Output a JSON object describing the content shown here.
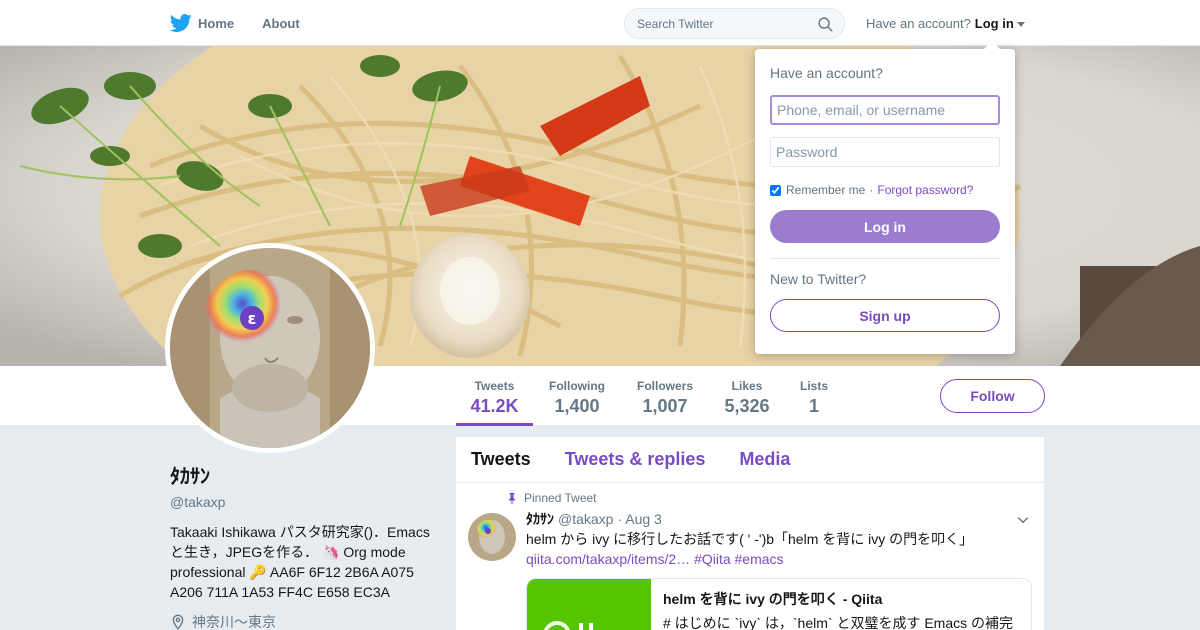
{
  "nav": {
    "home_label": "Home",
    "about_label": "About",
    "search_placeholder": "Search Twitter",
    "have_account": "Have an account?",
    "login_label": "Log in"
  },
  "profile": {
    "name": "ﾀｶｻﾝ",
    "handle": "@takaxp",
    "bio": "Takaaki Ishikawa パスタ研究家()．Emacs と生き，JPEGを作る． 🦄 Org mode professional 🔑 AA6F 6F12 2B6A A075 A206 711A 1A53 FF4C E658 EC3A",
    "location": "神奈川〜東京"
  },
  "stats": [
    {
      "label": "Tweets",
      "value": "41.2K",
      "active": true
    },
    {
      "label": "Following",
      "value": "1,400"
    },
    {
      "label": "Followers",
      "value": "1,007"
    },
    {
      "label": "Likes",
      "value": "5,326"
    },
    {
      "label": "Lists",
      "value": "1"
    }
  ],
  "follow_label": "Follow",
  "timeline": {
    "tabs": [
      "Tweets",
      "Tweets & replies",
      "Media"
    ],
    "pinned_label": "Pinned Tweet",
    "tweet": {
      "name": "ﾀｶｻﾝ",
      "handle": "@takaxp",
      "date": "· Aug 3",
      "text": "helm から ivy に移行したお話です( ' -')b「helm を背に ivy の門を叩く」",
      "link": "qiita.com/takaxp/items/2…",
      "hashtags": "#Qiita #emacs",
      "card_title": "helm を背に ivy の門を叩く - Qiita",
      "card_desc": "# はじめに `ivy` は，`helm` と双璧を成す Emacs の補完"
    }
  },
  "login_dropdown": {
    "title": "Have an account?",
    "username_placeholder": "Phone, email, or username",
    "password_placeholder": "Password",
    "remember_label": "Remember me",
    "forgot_label": "Forgot password?",
    "login_button": "Log in",
    "new_label": "New to Twitter?",
    "signup_button": "Sign up"
  },
  "colors": {
    "accent": "#794bc4",
    "login_button": "#9b7cd0",
    "qiita_green": "#55c500"
  },
  "icons": [
    "twitter-bird-icon",
    "search-icon",
    "caret-down-icon",
    "pin-icon",
    "location-icon",
    "chevron-down-icon"
  ]
}
